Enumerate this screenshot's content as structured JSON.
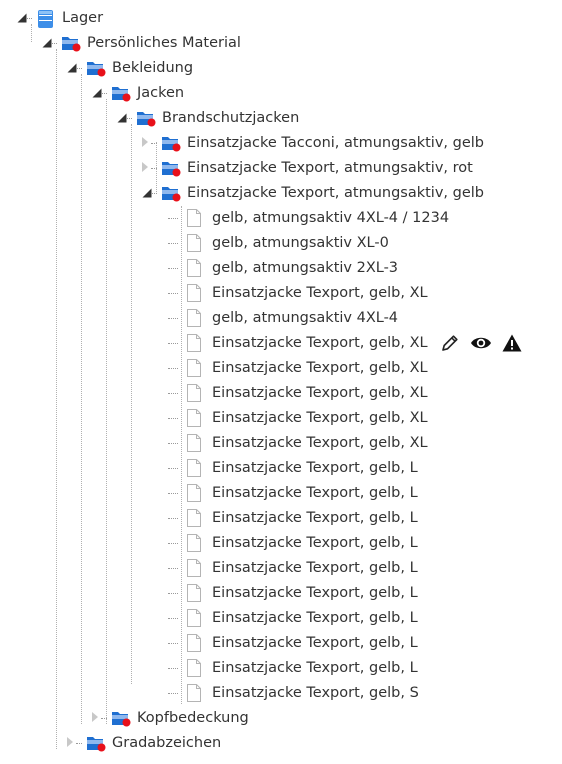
{
  "tree": {
    "nodes": [
      {
        "label": "Lager",
        "icon": "database-icon",
        "toggle": "open",
        "level": 0
      },
      {
        "label": "Persönliches Material",
        "icon": "material-icon",
        "toggle": "open",
        "level": 1
      },
      {
        "label": "Bekleidung",
        "icon": "material-icon",
        "toggle": "open",
        "level": 2
      },
      {
        "label": "Jacken",
        "icon": "material-icon",
        "toggle": "open",
        "level": 3
      },
      {
        "label": "Brandschutzjacken",
        "icon": "material-icon",
        "toggle": "open",
        "level": 4
      },
      {
        "label": "Einsatzjacke Tacconi, atmungsaktiv, gelb",
        "icon": "material-icon",
        "toggle": "closed",
        "level": 5
      },
      {
        "label": "Einsatzjacke Texport, atmungsaktiv, rot",
        "icon": "material-icon",
        "toggle": "closed",
        "level": 5
      },
      {
        "label": "Einsatzjacke Texport, atmungsaktiv, gelb",
        "icon": "material-icon",
        "toggle": "open",
        "level": 5
      },
      {
        "label": "gelb, atmungsaktiv 4XL-4 / 1234",
        "icon": "file-icon",
        "toggle": "leaf",
        "level": 6
      },
      {
        "label": "gelb, atmungsaktiv XL-0",
        "icon": "file-icon",
        "toggle": "leaf",
        "level": 6
      },
      {
        "label": "gelb, atmungsaktiv 2XL-3",
        "icon": "file-icon",
        "toggle": "leaf",
        "level": 6
      },
      {
        "label": "Einsatzjacke Texport, gelb, XL",
        "icon": "file-icon",
        "toggle": "leaf",
        "level": 6
      },
      {
        "label": "gelb, atmungsaktiv 4XL-4",
        "icon": "file-icon",
        "toggle": "leaf",
        "level": 6
      },
      {
        "label": "Einsatzjacke Texport, gelb, XL",
        "icon": "file-icon",
        "toggle": "leaf",
        "level": 6,
        "actions": [
          "edit-pencil-icon",
          "view-eye-icon",
          "warning-icon"
        ]
      },
      {
        "label": "Einsatzjacke Texport, gelb, XL",
        "icon": "file-icon",
        "toggle": "leaf",
        "level": 6
      },
      {
        "label": "Einsatzjacke Texport, gelb, XL",
        "icon": "file-icon",
        "toggle": "leaf",
        "level": 6
      },
      {
        "label": "Einsatzjacke Texport, gelb, XL",
        "icon": "file-icon",
        "toggle": "leaf",
        "level": 6
      },
      {
        "label": "Einsatzjacke Texport, gelb, XL",
        "icon": "file-icon",
        "toggle": "leaf",
        "level": 6
      },
      {
        "label": "Einsatzjacke Texport, gelb, L",
        "icon": "file-icon",
        "toggle": "leaf",
        "level": 6
      },
      {
        "label": "Einsatzjacke Texport, gelb, L",
        "icon": "file-icon",
        "toggle": "leaf",
        "level": 6
      },
      {
        "label": "Einsatzjacke Texport, gelb, L",
        "icon": "file-icon",
        "toggle": "leaf",
        "level": 6
      },
      {
        "label": "Einsatzjacke Texport, gelb, L",
        "icon": "file-icon",
        "toggle": "leaf",
        "level": 6
      },
      {
        "label": "Einsatzjacke Texport, gelb, L",
        "icon": "file-icon",
        "toggle": "leaf",
        "level": 6
      },
      {
        "label": "Einsatzjacke Texport, gelb, L",
        "icon": "file-icon",
        "toggle": "leaf",
        "level": 6
      },
      {
        "label": "Einsatzjacke Texport, gelb, L",
        "icon": "file-icon",
        "toggle": "leaf",
        "level": 6
      },
      {
        "label": "Einsatzjacke Texport, gelb, L",
        "icon": "file-icon",
        "toggle": "leaf",
        "level": 6
      },
      {
        "label": "Einsatzjacke Texport, gelb, L",
        "icon": "file-icon",
        "toggle": "leaf",
        "level": 6
      },
      {
        "label": "Einsatzjacke Texport, gelb, S",
        "icon": "file-icon",
        "toggle": "leaf",
        "level": 6
      },
      {
        "label": "Kopfbedeckung",
        "icon": "material-icon",
        "toggle": "closed",
        "level": 3
      },
      {
        "label": "Gradabzeichen",
        "icon": "material-icon",
        "toggle": "closed",
        "level": 2
      }
    ]
  },
  "colors": {
    "folder_blue": "#1f6fd1",
    "folder_light": "#8fb8ee",
    "badge_red": "#e8101a",
    "database_blue": "#3d8ee8",
    "file_border": "#b4b4b4"
  }
}
